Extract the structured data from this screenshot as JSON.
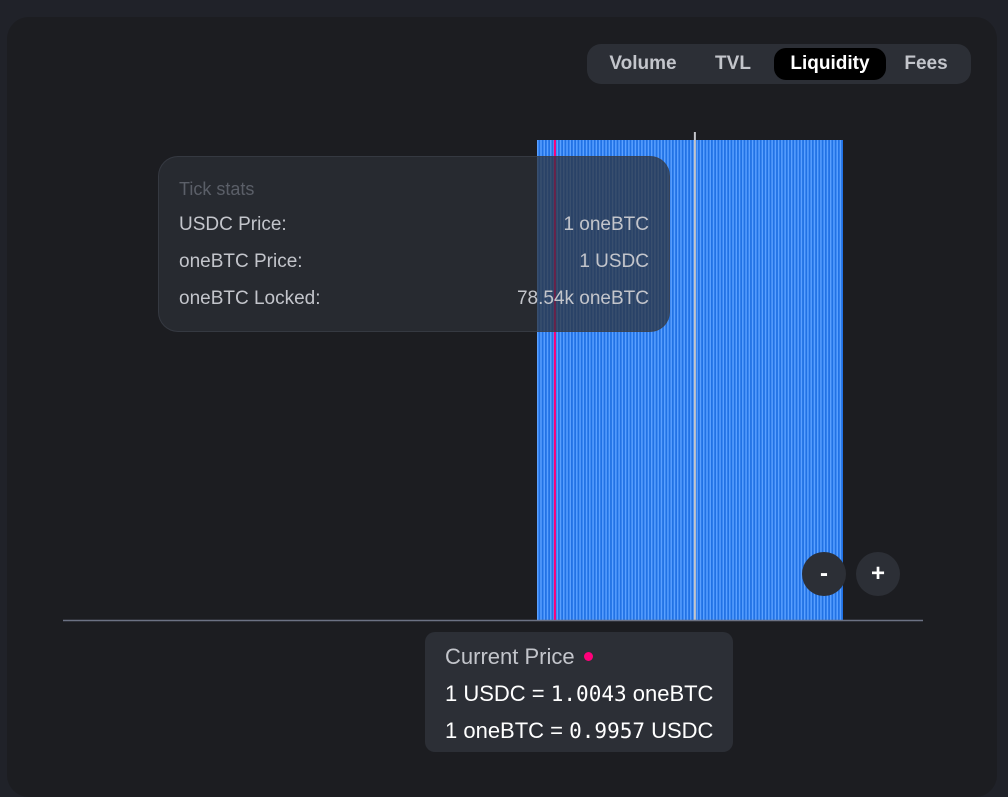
{
  "tabs": [
    {
      "label": "Volume",
      "active": false
    },
    {
      "label": "TVL",
      "active": false
    },
    {
      "label": "Liquidity",
      "active": true
    },
    {
      "label": "Fees",
      "active": false
    }
  ],
  "tick_stats": {
    "title": "Tick stats",
    "rows": [
      {
        "label": "USDC Price:",
        "value": "1 oneBTC"
      },
      {
        "label": "oneBTC Price:",
        "value": "1 USDC"
      },
      {
        "label": "oneBTC Locked:",
        "value": "78.54k oneBTC"
      }
    ]
  },
  "zoom": {
    "out_label": "-",
    "in_label": "+"
  },
  "current_price": {
    "title": "Current Price",
    "line1_prefix": "1 USDC = ",
    "line1_value": "1.0043",
    "line1_suffix": " oneBTC",
    "line2_prefix": "1 oneBTC = ",
    "line2_value": "0.9957",
    "line2_suffix": " USDC"
  },
  "colors": {
    "bar": "#2172e5",
    "bar_light": "#5aa0ff",
    "current_price_marker": "#ff007a",
    "hover_marker": "#c3c5cb",
    "axis": "#6c7284"
  },
  "chart_data": {
    "type": "bar",
    "title": "",
    "xlabel": "",
    "ylabel": "",
    "liquidity_bar_count": 94,
    "liquidity_relative_height": 1.0,
    "current_price_tick_index": 5,
    "hovered_tick_index": 48,
    "grid": false
  }
}
